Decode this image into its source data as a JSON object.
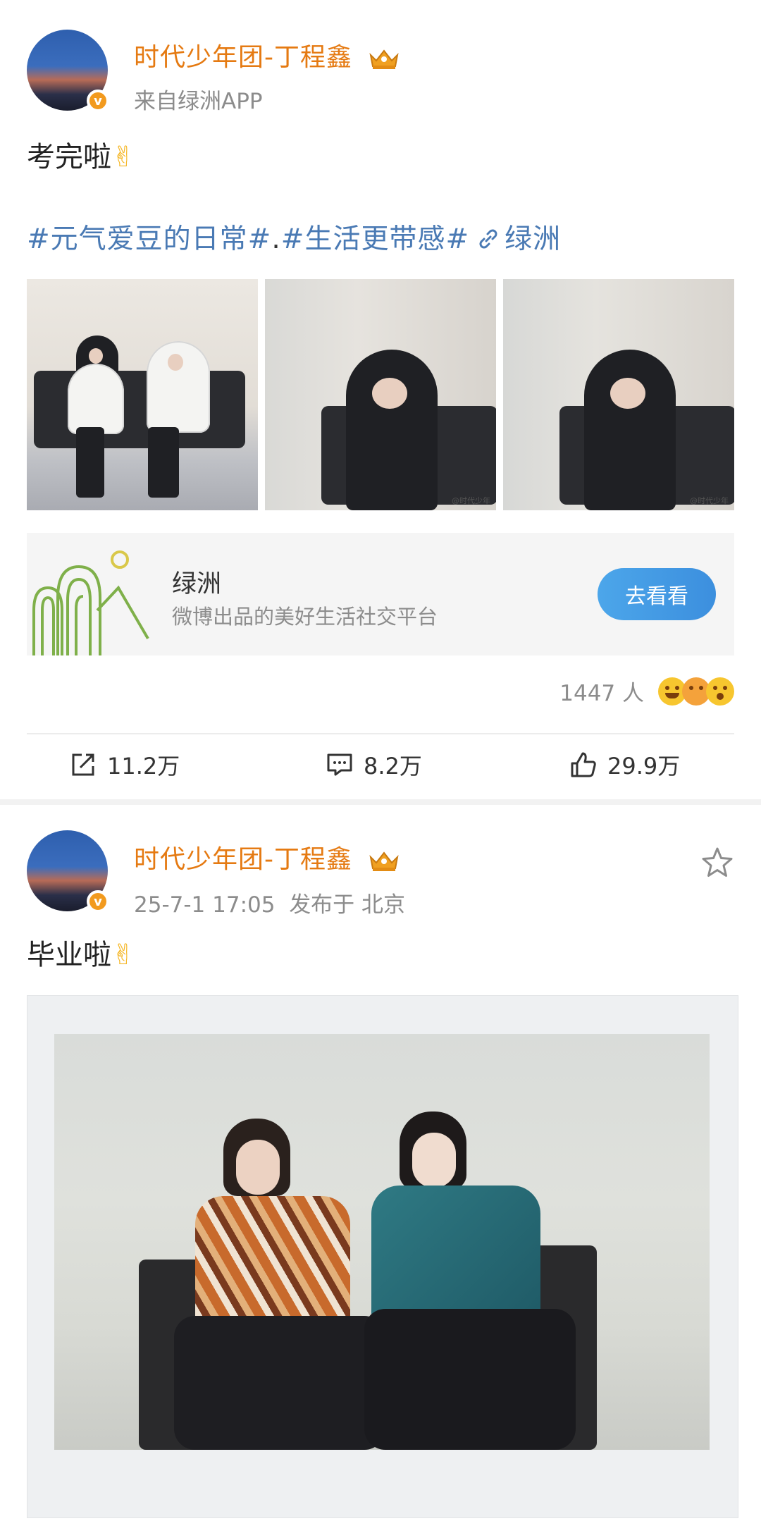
{
  "post1": {
    "username": "时代少年团-丁程鑫",
    "source": "来自绿洲APP",
    "text": "考完啦",
    "emoji": "✌",
    "topics": {
      "topic1": "#元气爱豆的日常#",
      "separator": ".",
      "topic2": "#生活更带感#",
      "link_label": "绿洲"
    },
    "watermarks": [
      "@时代少年",
      "@时代少年"
    ],
    "card": {
      "title": "绿洲",
      "description": "微博出品的美好生活社交平台",
      "button_label": "去看看"
    },
    "reaction_count": "1447 人",
    "actions": {
      "share": "11.2万",
      "comment": "8.2万",
      "like": "29.9万"
    }
  },
  "post2": {
    "username": "时代少年团-丁程鑫",
    "timestamp": "25-7-1 17:05",
    "location": "发布于 北京",
    "text": "毕业啦",
    "emoji": "✌"
  },
  "colors": {
    "username": "#e57a12",
    "topic": "#4a7ab4",
    "button": "#3c8fde",
    "meta": "#8c8c8c"
  },
  "icons": [
    "crown-badge-icon",
    "verified-v-icon",
    "link-icon",
    "share-icon",
    "comment-icon",
    "like-icon",
    "star-icon"
  ]
}
